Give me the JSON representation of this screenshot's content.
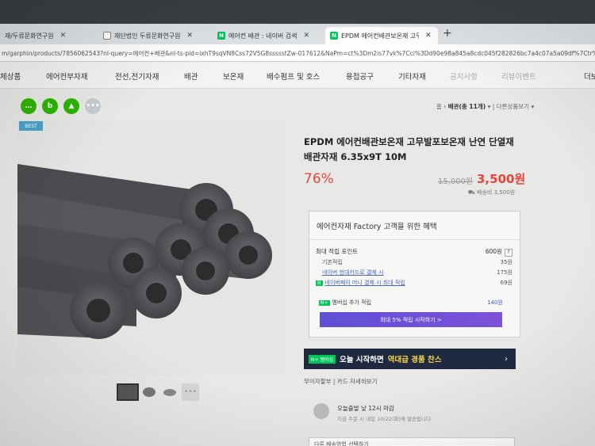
{
  "browser": {
    "tabs": [
      {
        "label": "재/두류문화연구원"
      },
      {
        "label": "재단법인 두류문화연구원"
      },
      {
        "label": "에어컨 배관 : 네이버 검색"
      },
      {
        "label": "EPDM 에어컨배관보온재 고무발포"
      }
    ],
    "address": "m/garphin/products/7856062543?nl-query=에어컨+배관&nl-ts-pid=ixhT9sqVN8Css72V5G8ssssstZw-017612&NaPm=ct%3Dm2is77vk%7Cci%3Dd90e98a845a8cdc045f282826bc7a4c07a5a09df%7Ctr%"
  },
  "nav": {
    "items": [
      "체상품",
      "에어컨부자재",
      "전선,전기자재",
      "배관",
      "보온재",
      "배수펌프 및 호스",
      "용접공구",
      "기타자재",
      "공지사항",
      "리뷰이벤트",
      "더보"
    ]
  },
  "breadcrumb": {
    "prefix": "홈",
    "current": "배관(총 11개)",
    "more": "다른상품보기"
  },
  "product": {
    "badge": "BEST",
    "title": "EPDM 에어컨배관보온재 고무발포보온재 난연 단열재 배관자재 6.35x9T 10M",
    "discount": "76%",
    "original_price": "15,000원",
    "price": "3,500원",
    "delivery": "배송비 3,500원"
  },
  "benefit": {
    "header": "에어컨자재 Factory 고객을 위한 혜택",
    "max_label": "최대 적립 포인트",
    "max_value": "600원",
    "rows": [
      {
        "label": "기본적립",
        "value": "35원"
      },
      {
        "label": "네이버 현대카드로 결제 시",
        "value": "175원"
      },
      {
        "label": "네이버페이 머니 결제 시 최대 적립",
        "value": "69원"
      }
    ],
    "membership_label": "멤버십 추가 적립",
    "membership_value": "140원",
    "membership_button": "최대 5% 적립 시작하기 >"
  },
  "banner": {
    "badge": "N+ 멤버십",
    "text": "오늘 시작하면",
    "highlight": "역대급 경품 찬스"
  },
  "extras": {
    "label": "무이자할부 | 카드 자세히보기"
  },
  "shipping": {
    "line1": "오늘출발 낮 12시 마감",
    "line2": "지금 주문 시 내일 10/22(화)에 발송됩니다."
  },
  "option": {
    "placeholder": "다른 배송방법 선택하기"
  },
  "colors": {
    "sale": "#e8443a",
    "naver": "#03c75a",
    "membership": "#6a50d7"
  }
}
